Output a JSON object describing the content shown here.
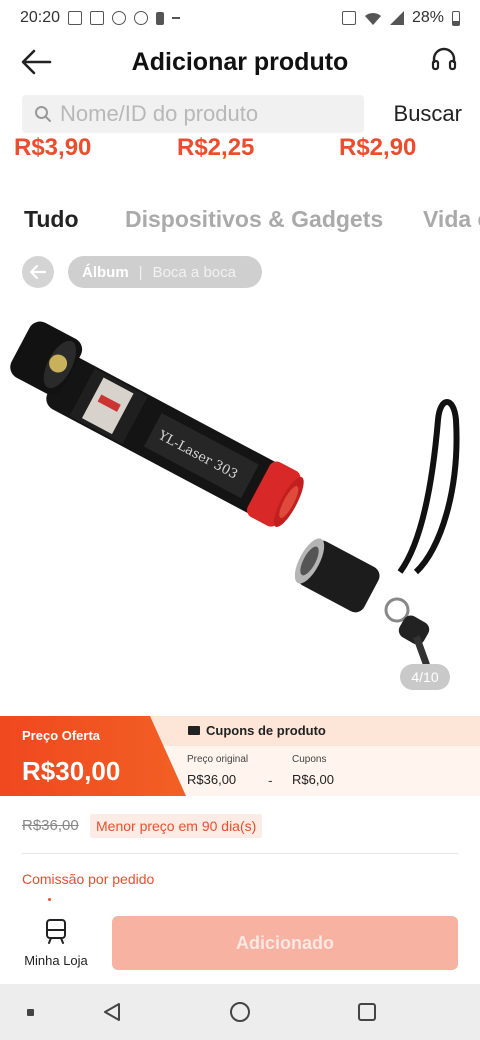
{
  "status_bar": {
    "time": "20:20",
    "battery": "28%"
  },
  "header": {
    "title": "Adicionar produto",
    "back_icon": "arrow-left-icon",
    "support_icon": "headset-icon"
  },
  "search": {
    "placeholder": "Nome/ID do produto",
    "button_label": "Buscar"
  },
  "prices_strip": [
    "R$3,90",
    "R$2,25",
    "R$2,90"
  ],
  "tabs": [
    {
      "label": "Tudo",
      "active": true
    },
    {
      "label": "Dispositivos & Gadgets",
      "active": false
    },
    {
      "label": "Vida e",
      "active": false
    }
  ],
  "album": {
    "active_label": "Álbum",
    "other_label": "Boca a boca"
  },
  "product_image": {
    "engraving": "YL-Laser 303",
    "page_indicator": "4/10",
    "current_page": 4,
    "total_pages": 10
  },
  "offer": {
    "label": "Preço Oferta",
    "price": "R$30,00",
    "coupons_title": "Cupons de produto",
    "original_label": "Preço original",
    "original_value": "R$36,00",
    "minus": "-",
    "coupons_label": "Cupons",
    "coupons_value": "R$6,00"
  },
  "price_info": {
    "old_price": "R$36,00",
    "lowest_badge": "Menor preço em 90 dia(s)",
    "commission_label": "Comissão por pedido"
  },
  "bottom": {
    "store_label": "Minha Loja",
    "added_label": "Adicionado"
  },
  "colors": {
    "accent": "#ee4d2d",
    "added_button": "#f7b2a2",
    "coupon_bg": "#fde6d8"
  }
}
